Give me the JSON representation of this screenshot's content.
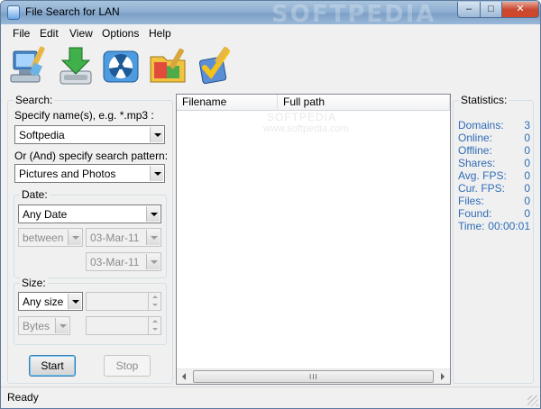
{
  "window": {
    "title": "File Search for LAN",
    "watermark": "SOFTPEDIA"
  },
  "title_buttons": {
    "minimize": "–",
    "maximize": "□",
    "close": "✕"
  },
  "menu": [
    "File",
    "Edit",
    "View",
    "Options",
    "Help"
  ],
  "toolbar": {
    "icons": [
      "computer-brush-icon",
      "download-arrow-icon",
      "radiation-icon",
      "folder-edit-icon",
      "checkmark-brush-icon"
    ]
  },
  "search": {
    "group_label": "Search:",
    "name_label": "Specify name(s), e.g. *.mp3 :",
    "name_value": "Softpedia",
    "pattern_label": "Or (And) specify search pattern:",
    "pattern_value": "Pictures and Photos",
    "date": {
      "group_label": "Date:",
      "date_value": "Any Date",
      "range_value": "between",
      "from_date": "03-Mar-11",
      "to_date": "03-Mar-11"
    },
    "size": {
      "group_label": "Size:",
      "size_value": "Any size",
      "unit_value": "Bytes"
    },
    "start_label": "Start",
    "stop_label": "Stop"
  },
  "results": {
    "columns": [
      "Filename",
      "Full path"
    ],
    "watermark_top": "SOFTPEDIA",
    "watermark_url": "www.softpedia.com",
    "scroll_grip": "III"
  },
  "statistics": {
    "group_label": "Statistics:",
    "rows": [
      {
        "label": "Domains:",
        "value": "3"
      },
      {
        "label": "Online:",
        "value": "0"
      },
      {
        "label": "Offline:",
        "value": "0"
      },
      {
        "label": "Shares:",
        "value": "0"
      },
      {
        "label": "Avg. FPS:",
        "value": "0"
      },
      {
        "label": "Cur. FPS:",
        "value": "0"
      },
      {
        "label": "Files:",
        "value": "0"
      },
      {
        "label": "Found:",
        "value": "0"
      },
      {
        "label": "Time:",
        "value": "00:00:01"
      }
    ]
  },
  "status": {
    "text": "Ready"
  }
}
